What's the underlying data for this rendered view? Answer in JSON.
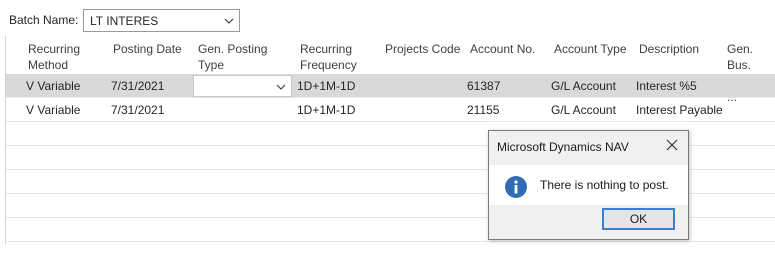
{
  "batch": {
    "label": "Batch Name:",
    "value": "LT INTERES"
  },
  "columns": [
    "Recurring\nMethod",
    "Posting Date",
    "Gen. Posting\nType",
    "Recurring\nFrequency",
    "Projects Code",
    "Account No.",
    "Account Type",
    "Description",
    "Gen. Bus.\nPosting ..."
  ],
  "rows": [
    {
      "recurring_method": "V  Variable",
      "posting_date": "7/31/2021",
      "gen_posting_type": "",
      "recurring_frequency": "1D+1M-1D",
      "projects_code": "",
      "account_no": "61387",
      "account_type": "G/L Account",
      "description": "Interest %5",
      "gen_bus_posting": ""
    },
    {
      "recurring_method": "V  Variable",
      "posting_date": "7/31/2021",
      "gen_posting_type": "",
      "recurring_frequency": "1D+1M-1D",
      "projects_code": "",
      "account_no": "21155",
      "account_type": "G/L Account",
      "description": "Interest Payable",
      "gen_bus_posting": ""
    }
  ],
  "dialog": {
    "title": "Microsoft Dynamics NAV",
    "message": "There is nothing to post.",
    "ok_label": "OK",
    "icon": "info-icon"
  },
  "colors": {
    "selected_row": "#d9d9d9",
    "info_blue": "#2f6eb5",
    "focus_border": "#3b7fd0"
  }
}
